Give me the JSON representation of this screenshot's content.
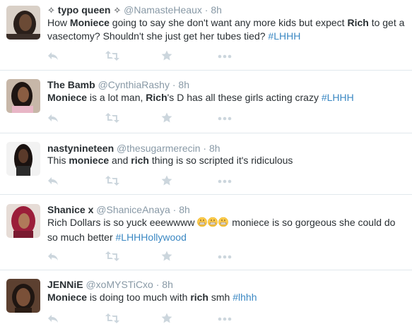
{
  "tweets": [
    {
      "name": "typo queen",
      "name_prefix": "✧",
      "name_suffix": "✧",
      "handle": "@NamasteHeaux",
      "separator": "·",
      "time": "8h",
      "text_parts": [
        "How ",
        "Moniece",
        " going to say she don't want any more kids but expect ",
        "Rich",
        " to get a vasectomy? Shouldn't she just get her tubes tied? ",
        "#LHHH"
      ]
    },
    {
      "name": "The Bamb",
      "handle": "@CynthiaRashy",
      "separator": "·",
      "time": "8h",
      "text_parts": [
        "Moniece",
        " is a lot man, ",
        "Rich",
        "'s D has all these girls acting crazy ",
        "#LHHH"
      ]
    },
    {
      "name": "nastynineteen",
      "handle": "@thesugarmerecin",
      "separator": "·",
      "time": "8h",
      "text_parts": [
        "This ",
        "moniece",
        " and ",
        "rich",
        " thing is so scripted it's ridiculous"
      ]
    },
    {
      "name": "Shanice x",
      "handle": "@ShaniceAnaya",
      "separator": "·",
      "time": "8h",
      "text_parts": [
        "Rich Dollars is so yuck eeewwww ",
        " moniece is so gorgeous she could do so much better ",
        "#LHHHollywood"
      ]
    },
    {
      "name": "JENNiE",
      "handle": "@xoMYSTiCxo",
      "separator": "·",
      "time": "8h",
      "text_parts": [
        "Moniece",
        " is doing too much with ",
        "rich",
        " smh ",
        "#lhhh"
      ]
    }
  ],
  "icons": {
    "reply": "reply-icon",
    "retweet": "retweet-icon",
    "favorite": "star-icon",
    "more": "more-icon",
    "emoji": "grimacing-face-emoji"
  },
  "colors": {
    "text": "#292f33",
    "meta": "#8899a6",
    "hashtag": "#3b88c3",
    "action_icon": "#ccd6dd",
    "divider": "#e1e8ed"
  }
}
